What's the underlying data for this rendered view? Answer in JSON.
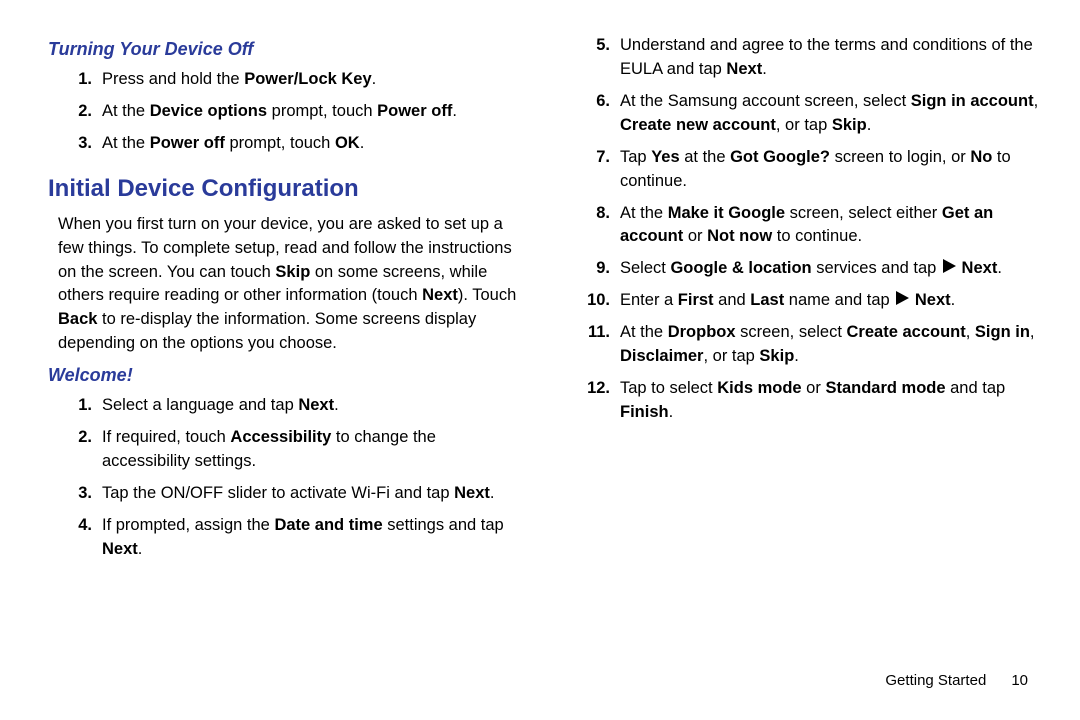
{
  "left": {
    "sub1": "Turning Your Device Off",
    "off_list": [
      "Press and hold the <b>Power/Lock Key</b>.",
      "At the <b>Device options</b> prompt, touch <b>Power off</b>.",
      "At the <b>Power off</b> prompt, touch <b>OK</b>."
    ],
    "h_main": "Initial Device Configuration",
    "intro": "When you first turn on your device, you are asked to set up a few things. To complete setup, read and follow the instructions on the screen. You can touch <b>Skip</b> on some screens, while others require reading or other information (touch <b>Next</b>). Touch <b>Back</b> to re-display the information. Some screens display depending on the options you choose.",
    "sub2": "Welcome!",
    "welcome_list": [
      "Select a language and tap <b>Next</b>.",
      "If required, touch <b>Accessibility</b> to change the accessibility settings.",
      "Tap the ON/OFF slider to activate Wi-Fi and tap <b>Next</b>.",
      "If prompted, assign the <b>Date and time</b> settings and tap <b>Next</b>."
    ]
  },
  "right": {
    "welcome_cont": [
      "Understand and agree to the terms and conditions of the EULA and tap <b>Next</b>.",
      "At the Samsung account screen, select <b>Sign in account</b>, <b>Create new account</b>, or tap <b>Skip</b>.",
      "Tap <b>Yes</b> at the <b>Got Google?</b> screen to login, or <b>No</b> to continue.",
      "At the <b>Make it Google</b> screen, select either <b>Get an account</b> or <b>Not now</b> to continue.",
      "Select <b>Google & location</b> services and tap {{TRI}} <b>Next</b>.",
      "Enter a <b>First</b> and <b>Last</b> name and tap {{TRI}} <b>Next</b>.",
      "At the <b>Dropbox</b> screen, select <b>Create account</b>, <b>Sign in</b>, <b>Disclaimer</b>, or tap <b>Skip</b>.",
      "Tap to select <b>Kids mode</b> or <b>Standard mode</b> and tap <b>Finish</b>."
    ]
  },
  "footer": {
    "section": "Getting Started",
    "page": "10"
  },
  "icons": {
    "triangle": "▶"
  }
}
